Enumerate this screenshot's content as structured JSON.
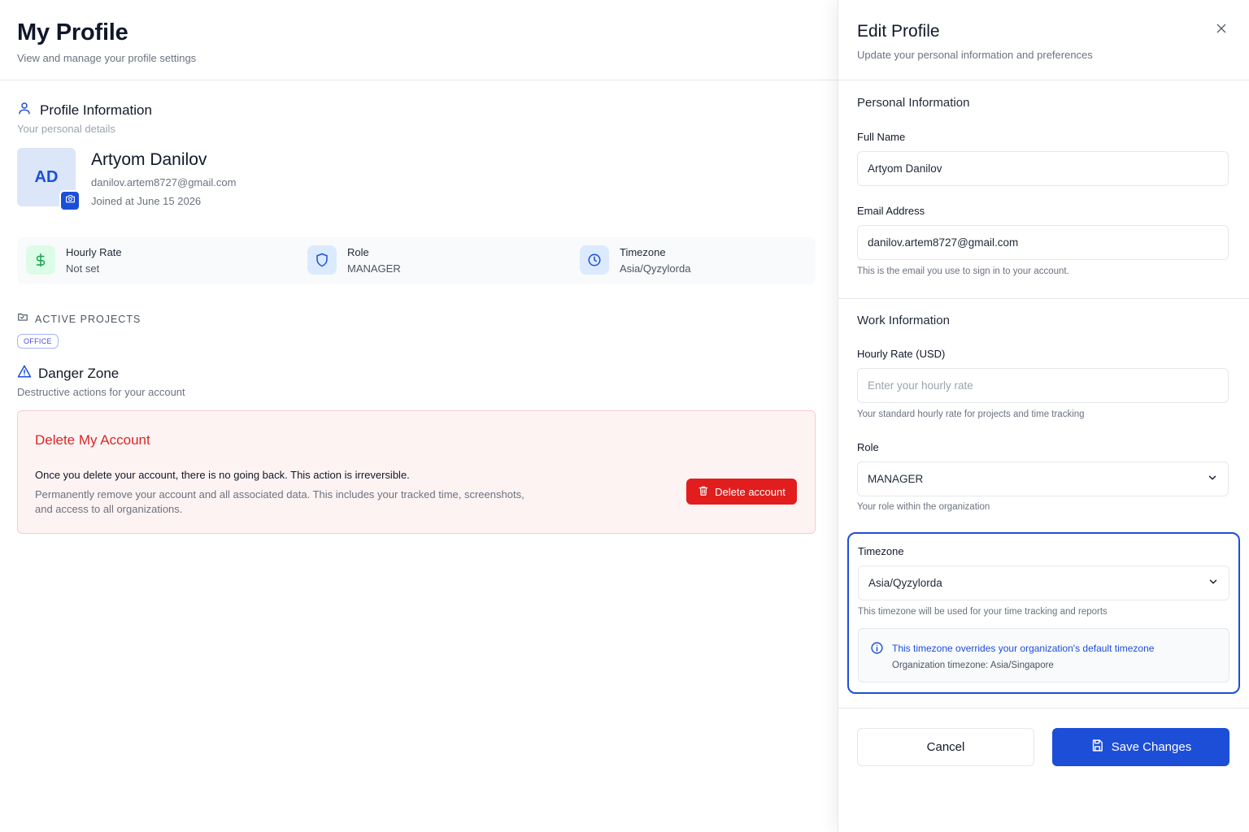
{
  "header": {
    "title": "My Profile",
    "subtitle": "View and manage your profile settings"
  },
  "profile_info": {
    "title": "Profile Information",
    "subtitle": "Your personal details",
    "avatar_initials": "AD",
    "name": "Artyom Danilov",
    "email": "danilov.artem8727@gmail.com",
    "joined": "Joined at June 15 2026"
  },
  "stats": [
    {
      "label": "Hourly Rate",
      "value": "Not set",
      "icon": "dollar-icon",
      "color": "#16a34a"
    },
    {
      "label": "Role",
      "value": "MANAGER",
      "icon": "shield-icon",
      "color": "#1d4ed8"
    },
    {
      "label": "Timezone",
      "value": "Asia/Qyzylorda",
      "icon": "clock-icon",
      "color": "#1d4ed8"
    }
  ],
  "projects": {
    "title": "ACTIVE PROJECTS",
    "badges": [
      "OFFICE"
    ]
  },
  "danger": {
    "title": "Danger Zone",
    "subtitle": "Destructive actions for your account",
    "box_title": "Delete My Account",
    "warning": "Once you delete your account, there is no going back. This action is irreversible.",
    "description": "Permanently remove your account and all associated data. This includes your tracked time, screenshots, and access to all organizations.",
    "button_label": "Delete account"
  },
  "drawer": {
    "title": "Edit Profile",
    "subtitle": "Update your personal information and preferences",
    "personal_title": "Personal Information",
    "full_name_label": "Full Name",
    "full_name_value": "Artyom Danilov",
    "email_label": "Email Address",
    "email_value": "danilov.artem8727@gmail.com",
    "email_helper": "This is the email you use to sign in to your account.",
    "work_title": "Work Information",
    "rate_label": "Hourly Rate (USD)",
    "rate_placeholder": "Enter your hourly rate",
    "rate_helper": "Your standard hourly rate for projects and time tracking",
    "role_label": "Role",
    "role_value": "MANAGER",
    "role_helper": "Your role within the organization",
    "timezone_label": "Timezone",
    "timezone_value": "Asia/Qyzylorda",
    "timezone_helper": "This timezone will be used for your time tracking and reports",
    "override_title": "This timezone overrides your organization's default timezone",
    "override_sub": "Organization timezone: Asia/Singapore",
    "cancel_label": "Cancel",
    "save_label": "Save Changes"
  },
  "colors": {
    "primary": "#1d4ed8",
    "danger": "#e11d1d",
    "danger_bg": "#fef3f3"
  }
}
